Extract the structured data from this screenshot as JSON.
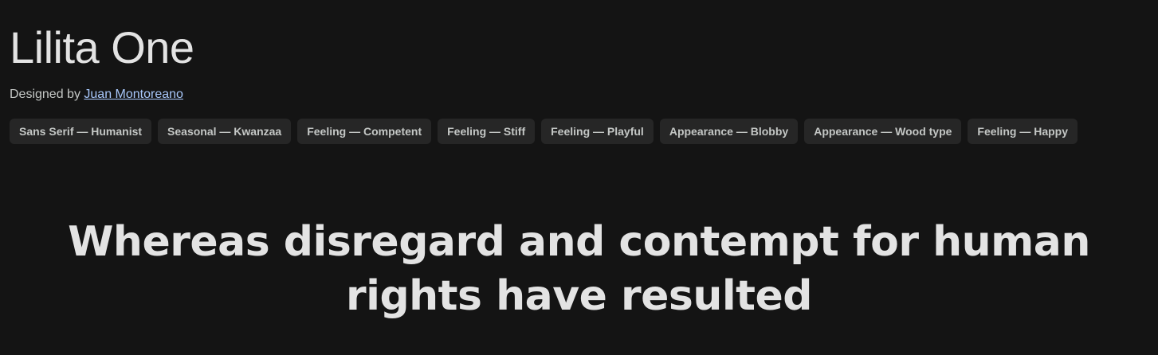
{
  "font": {
    "name": "Lilita One",
    "designed_by_label": "Designed by",
    "designer": "Juan Montoreano"
  },
  "tags": [
    "Sans Serif — Humanist",
    "Seasonal — Kwanzaa",
    "Feeling — Competent",
    "Feeling — Stiff",
    "Feeling — Playful",
    "Appearance — Blobby",
    "Appearance — Wood type",
    "Feeling — Happy"
  ],
  "specimen": {
    "text": "Whereas disregard and contempt for human rights have resulted"
  },
  "colors": {
    "background": "#141414",
    "text": "#e3e3e3",
    "link": "#a8c7fa",
    "tag_background": "#262626"
  }
}
